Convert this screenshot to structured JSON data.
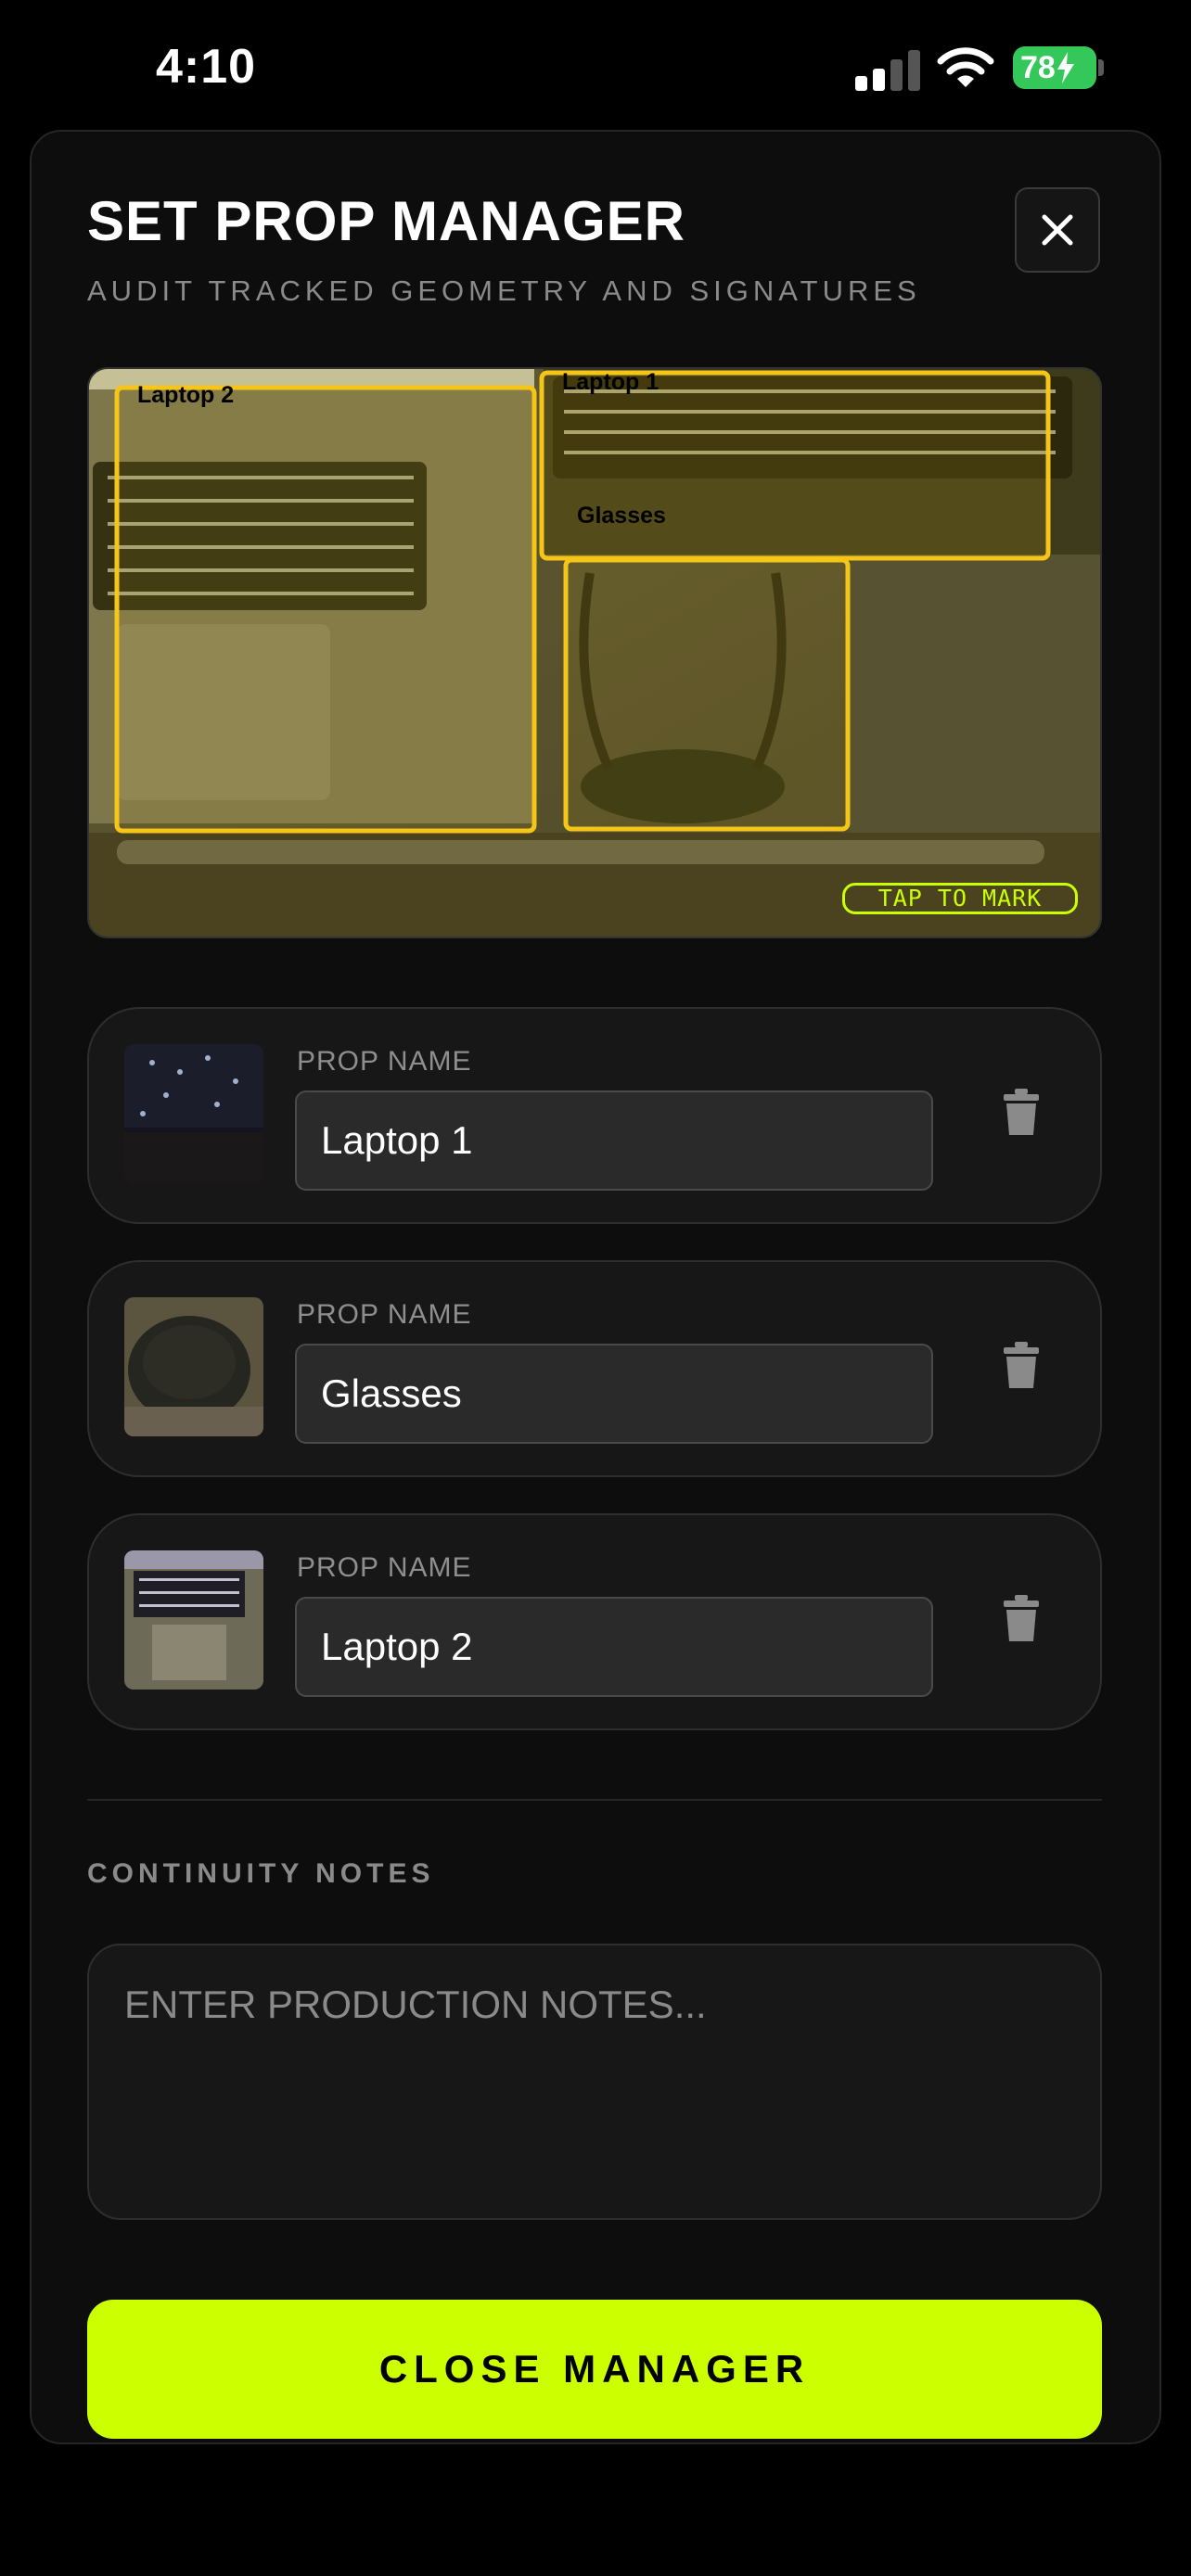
{
  "status_bar": {
    "time": "4:10",
    "battery": "78"
  },
  "header": {
    "title": "SET PROP MANAGER",
    "subtitle": "AUDIT TRACKED GEOMETRY AND SIGNATURES",
    "close_icon": "close-icon"
  },
  "preview": {
    "tap_label": "TAP TO MARK",
    "box_labels": [
      "Laptop 2",
      "Laptop 1",
      "Glasses"
    ],
    "box_color": "#f5c518"
  },
  "props": [
    {
      "label": "PROP NAME",
      "value": "Laptop 1",
      "icon": "trash-icon"
    },
    {
      "label": "PROP NAME",
      "value": "Glasses",
      "icon": "trash-icon"
    },
    {
      "label": "PROP NAME",
      "value": "Laptop 2",
      "icon": "trash-icon"
    }
  ],
  "notes": {
    "label": "CONTINUITY NOTES",
    "placeholder": "ENTER PRODUCTION NOTES..."
  },
  "actions": {
    "close_label": "CLOSE MANAGER"
  },
  "colors": {
    "accent": "#ccff00",
    "battery": "#34c759"
  }
}
